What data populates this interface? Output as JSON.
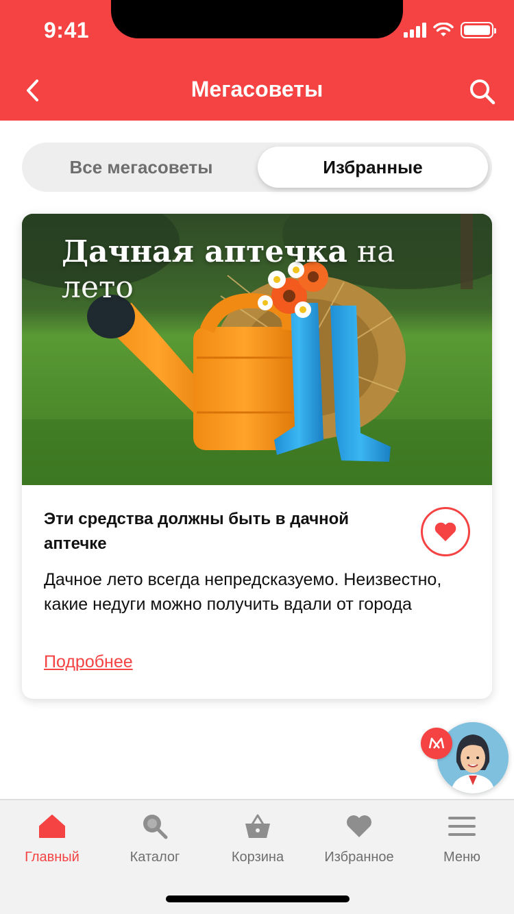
{
  "status": {
    "time": "9:41"
  },
  "header": {
    "title": "Мегасоветы",
    "back_icon": "chevron-left-icon",
    "search_icon": "search-icon"
  },
  "segments": {
    "all_label": "Все мегасоветы",
    "favorites_label": "Избранные",
    "selected": "favorites"
  },
  "card": {
    "image_title_bold": "Дачная аптечка",
    "image_title_light": "на лето",
    "heading": "Эти средства должны быть в дачной аптечке",
    "text": "Дачное лето всегда непредсказуемо. Неизвестно, какие недуги можно получить вдали от города",
    "more_link": "Подробнее",
    "favorited": true
  },
  "tabbar": {
    "items": [
      {
        "label": "Главный",
        "icon": "home-icon",
        "active": true
      },
      {
        "label": "Каталог",
        "icon": "search-icon",
        "active": false
      },
      {
        "label": "Корзина",
        "icon": "basket-icon",
        "active": false
      },
      {
        "label": "Избранное",
        "icon": "heart-icon",
        "active": false
      },
      {
        "label": "Меню",
        "icon": "menu-icon",
        "active": false
      }
    ]
  },
  "colors": {
    "accent": "#f54242",
    "tab_inactive": "#6e6e6e",
    "tabbar_bg": "#f2f2f2"
  }
}
